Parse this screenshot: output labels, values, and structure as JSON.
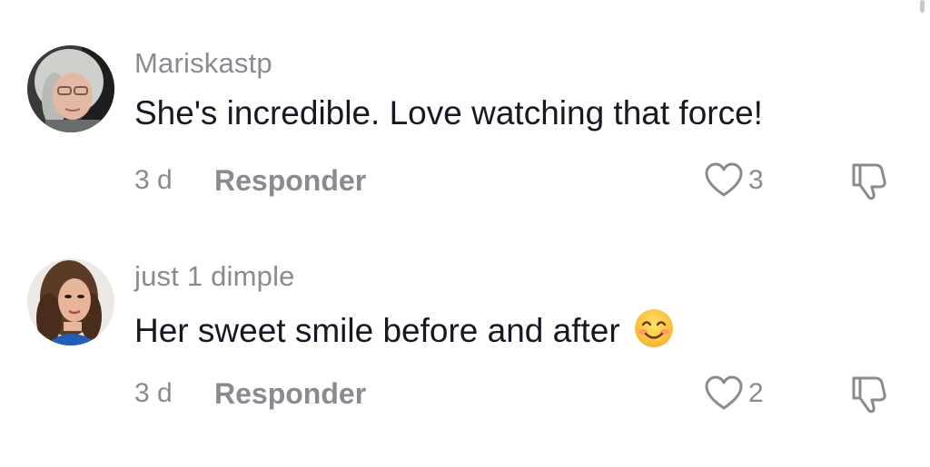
{
  "comments": [
    {
      "username": "Mariskastp",
      "text": "She's incredible. Love watching that force!",
      "emoji": "",
      "time": "3 d",
      "reply_label": "Responder",
      "likes": "3"
    },
    {
      "username": "just 1 dimple",
      "text": "Her sweet smile before and after",
      "emoji": "smiling-face-icon",
      "time": "3 d",
      "reply_label": "Responder",
      "likes": "2"
    }
  ],
  "colors": {
    "muted": "#8a8b91",
    "text": "#161823",
    "background": "#ffffff"
  }
}
